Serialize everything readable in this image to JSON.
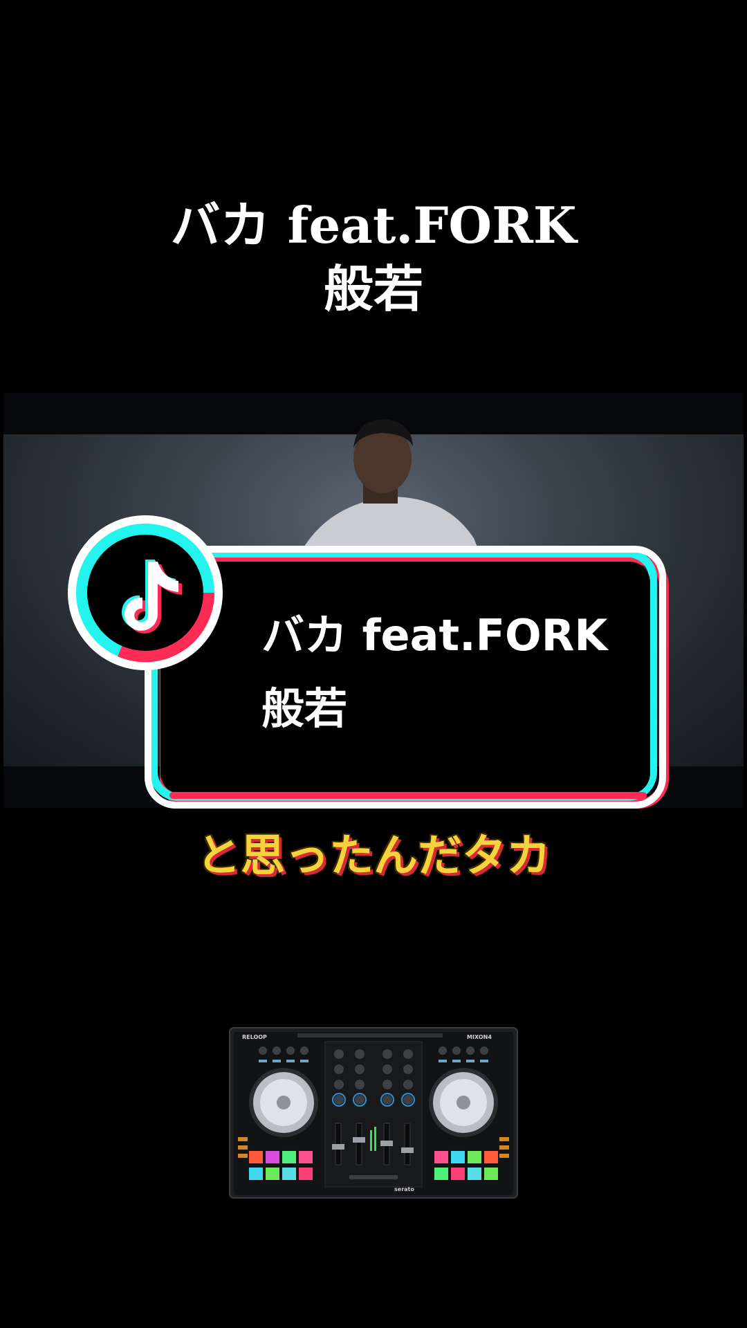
{
  "title": {
    "line1": "バカ feat.FORK",
    "line2": "般若"
  },
  "card": {
    "line1": "バカ feat.FORK",
    "line2": "般若",
    "icon": "tiktok-logo-icon",
    "colors": {
      "cyan": "#25f4ee",
      "pink": "#fe2c55",
      "white": "#ffffff",
      "black": "#000000"
    }
  },
  "subtitle": "と思ったんだタカ",
  "controller": {
    "brand": "RELOOP",
    "model": "MIXON4",
    "software": "serato"
  }
}
